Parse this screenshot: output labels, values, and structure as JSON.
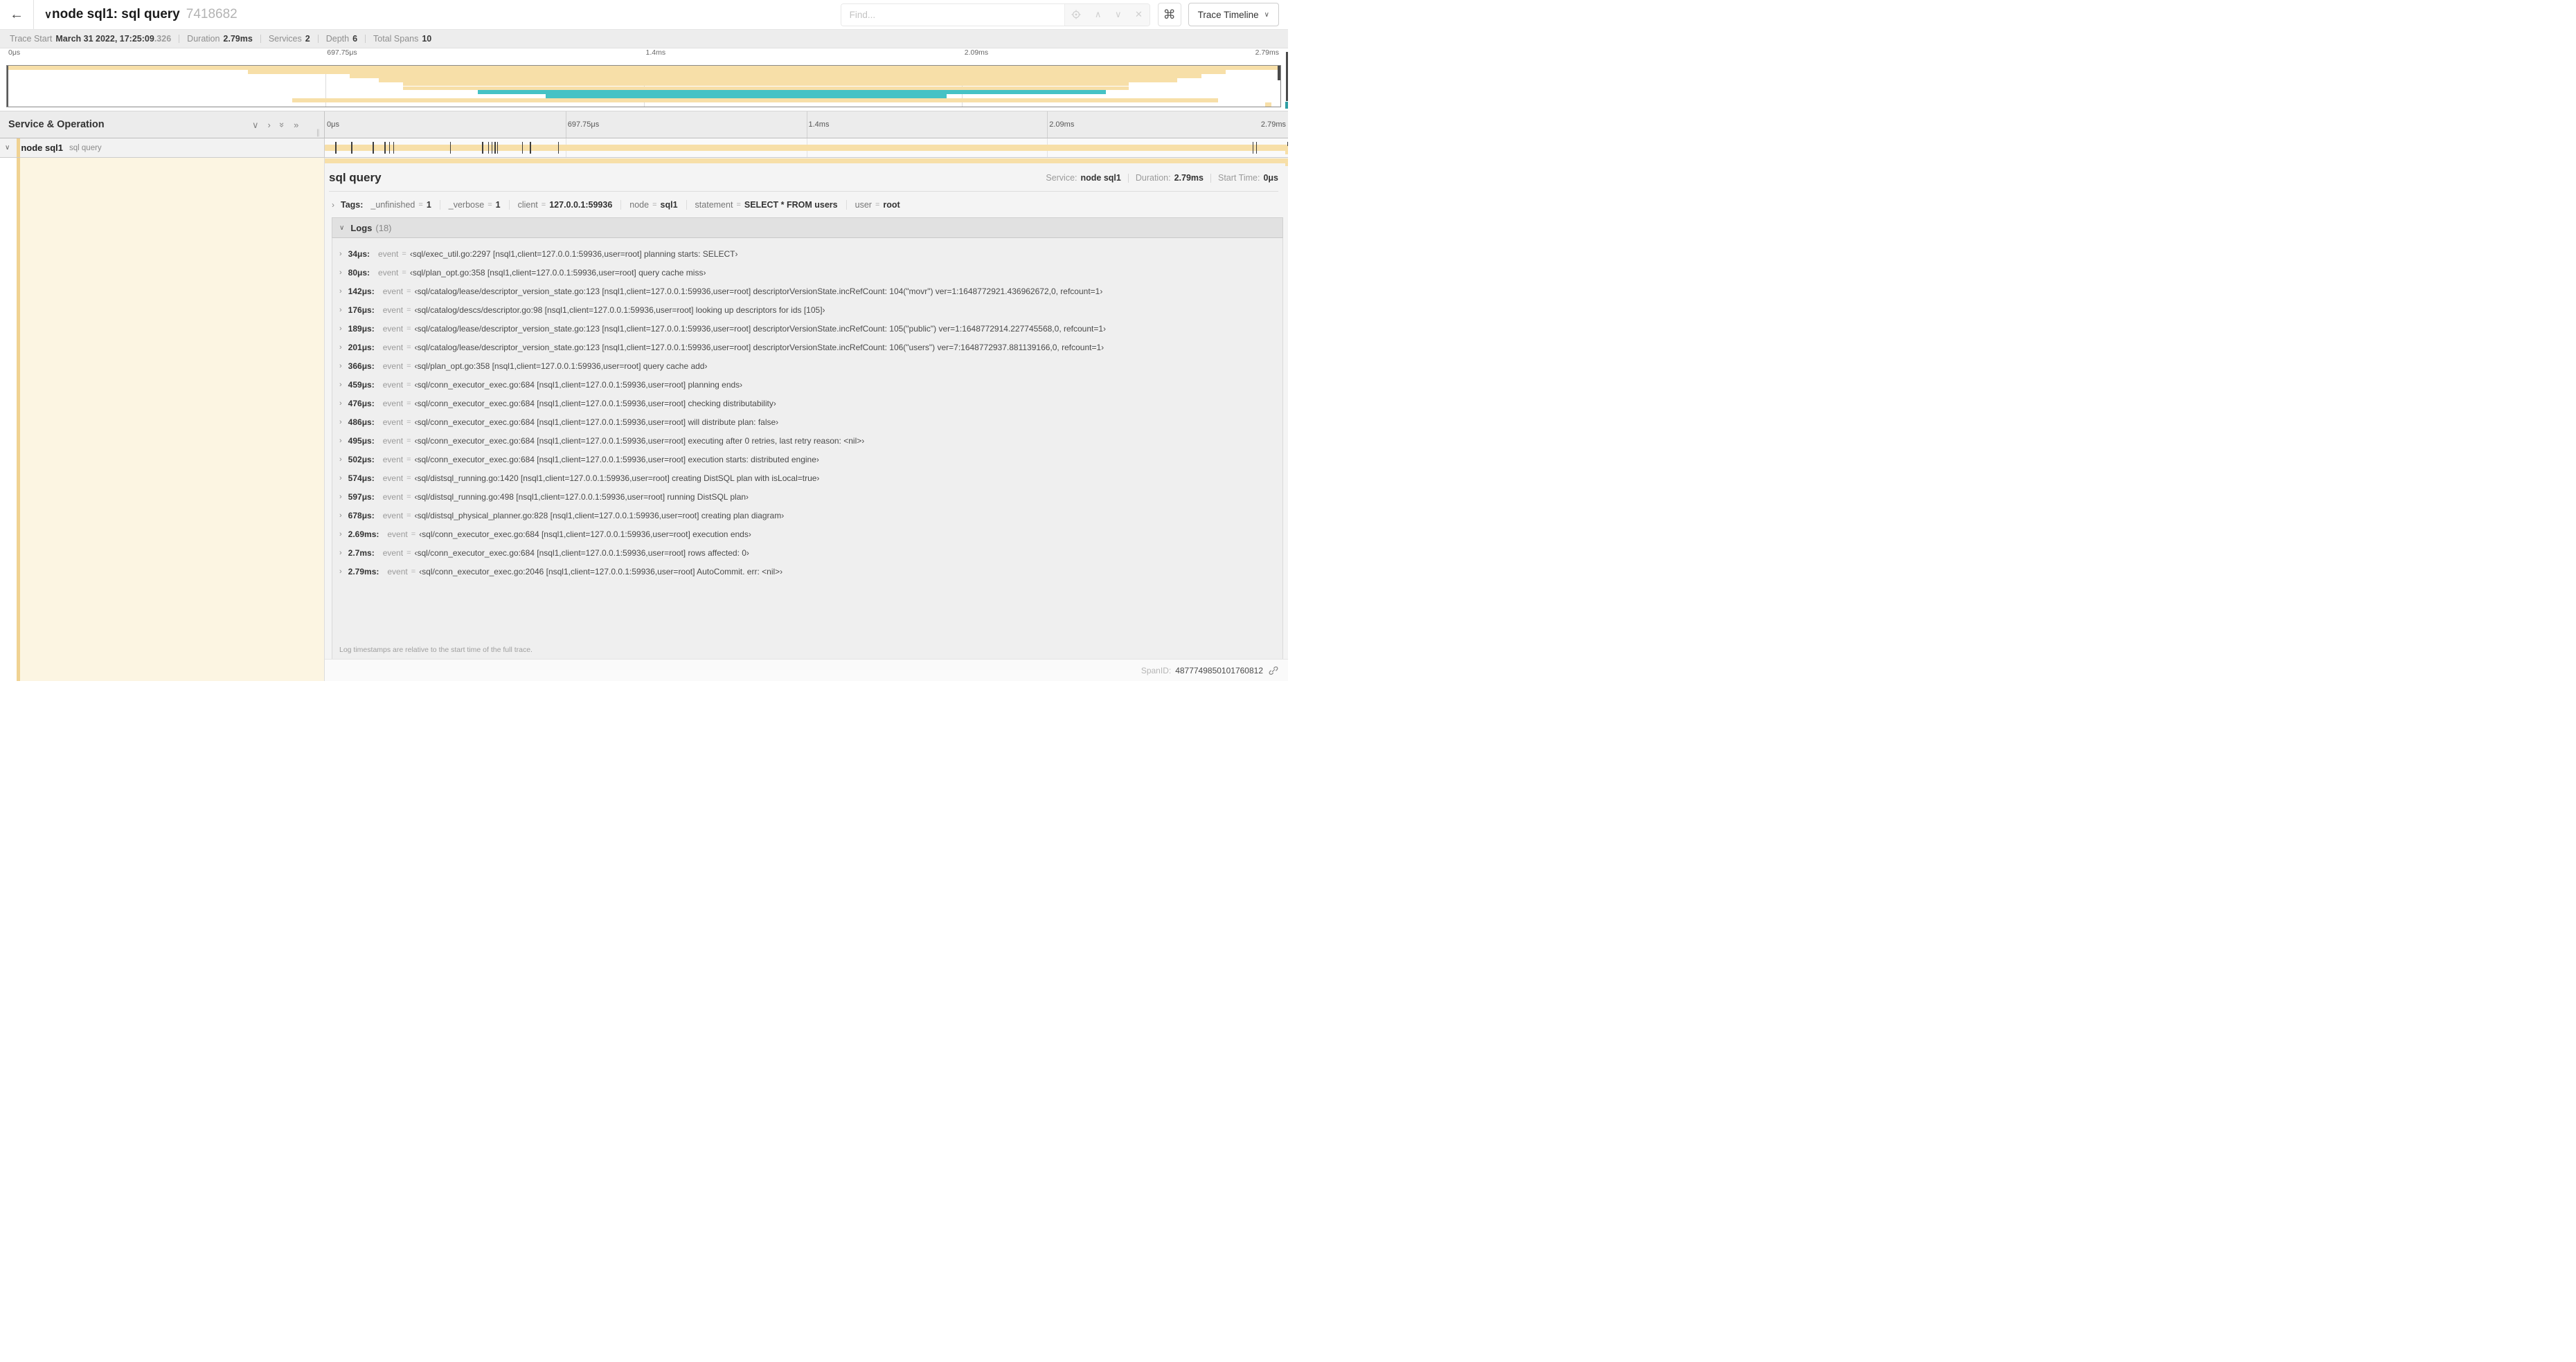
{
  "colors": {
    "span_tan": "#f7dfa8",
    "span_stripe": "#f0d292",
    "span_cream": "#fcf5e2",
    "teal": "#45c2c5",
    "edge_dark": "#4a4a4a",
    "edge_teal": "#2f9ea4"
  },
  "topbar": {
    "back_icon": "←",
    "collapse_icon": "∨",
    "title": "node sql1: sql query",
    "trace_id": "7418682",
    "find_placeholder": "Find...",
    "up_icon": "∧",
    "down_icon": "∨",
    "clear_icon": "✕",
    "command_icon": "⌘",
    "view_button": "Trace Timeline",
    "view_chevron": "∨"
  },
  "summary": {
    "items": [
      {
        "label": "Trace Start",
        "value": "March 31 2022, 17:25:09",
        "suffix": ".326"
      },
      {
        "label": "Duration",
        "value": "2.79ms"
      },
      {
        "label": "Services",
        "value": "2"
      },
      {
        "label": "Depth",
        "value": "6"
      },
      {
        "label": "Total Spans",
        "value": "10"
      }
    ]
  },
  "ticks": [
    "0μs",
    "697.75μs",
    "1.4ms",
    "2.09ms",
    "2.79ms"
  ],
  "minimap": {
    "rows": [
      {
        "start": 0.0,
        "end": 1.0,
        "color": "tan"
      },
      {
        "start": 0.189,
        "end": 0.957,
        "color": "tan"
      },
      {
        "start": 0.269,
        "end": 0.938,
        "color": "tan"
      },
      {
        "start": 0.292,
        "end": 0.919,
        "color": "tan"
      },
      {
        "start": 0.311,
        "end": 0.881,
        "color": "tan"
      },
      {
        "start": 0.311,
        "end": 0.881,
        "color": "tan"
      },
      {
        "start": 0.37,
        "end": 0.863,
        "color": "teal"
      },
      {
        "start": 0.423,
        "end": 0.738,
        "color": "teal"
      },
      {
        "start": 0.224,
        "end": 0.951,
        "color": "tan"
      },
      {
        "start": 0.988,
        "end": 0.993,
        "color": "tan"
      }
    ]
  },
  "timeline": {
    "column_header": "Service & Operation",
    "header_icons": [
      {
        "name": "collapse-one-icon",
        "glyph": "∨",
        "rot": 0
      },
      {
        "name": "expand-one-icon",
        "glyph": "›",
        "rot": 0
      },
      {
        "name": "collapse-all-icon",
        "glyph": "»",
        "rot": 90
      },
      {
        "name": "expand-all-icon",
        "glyph": "»",
        "rot": 0
      }
    ],
    "resizer_glyph": "∥"
  },
  "span": {
    "chevron": "∨",
    "service": "node sql1",
    "operation": "sql query",
    "duration_us": 2790,
    "log_times_us": [
      34,
      80,
      142,
      176,
      189,
      201,
      366,
      459,
      476,
      486,
      495,
      502,
      574,
      597,
      678,
      2690,
      2700,
      2790
    ]
  },
  "detail": {
    "title": "sql query",
    "service_label": "Service:",
    "service": "node sql1",
    "duration_label": "Duration:",
    "duration": "2.79ms",
    "start_label": "Start Time:",
    "start": "0μs"
  },
  "tags": {
    "chevron": "›",
    "label": "Tags:",
    "items": [
      {
        "key": "_unfinished",
        "value": "1"
      },
      {
        "key": "_verbose",
        "value": "1"
      },
      {
        "key": "client",
        "value": "127.0.0.1:59936"
      },
      {
        "key": "node",
        "value": "sql1"
      },
      {
        "key": "statement",
        "value": "SELECT * FROM users"
      },
      {
        "key": "user",
        "value": "root"
      }
    ]
  },
  "logs": {
    "chevron": "∨",
    "label": "Logs",
    "count": "(18)",
    "row_chevron": "›",
    "entries": [
      {
        "time": "34μs:",
        "key": "event",
        "value": "‹sql/exec_util.go:2297 [nsql1,client=127.0.0.1:59936,user=root] planning starts: SELECT›"
      },
      {
        "time": "80μs:",
        "key": "event",
        "value": "‹sql/plan_opt.go:358 [nsql1,client=127.0.0.1:59936,user=root] query cache miss›"
      },
      {
        "time": "142μs:",
        "key": "event",
        "value": "‹sql/catalog/lease/descriptor_version_state.go:123 [nsql1,client=127.0.0.1:59936,user=root] descriptorVersionState.incRefCount: 104(\"movr\") ver=1:1648772921.436962672,0, refcount=1›"
      },
      {
        "time": "176μs:",
        "key": "event",
        "value": "‹sql/catalog/descs/descriptor.go:98 [nsql1,client=127.0.0.1:59936,user=root] looking up descriptors for ids [105]›"
      },
      {
        "time": "189μs:",
        "key": "event",
        "value": "‹sql/catalog/lease/descriptor_version_state.go:123 [nsql1,client=127.0.0.1:59936,user=root] descriptorVersionState.incRefCount: 105(\"public\") ver=1:1648772914.227745568,0, refcount=1›"
      },
      {
        "time": "201μs:",
        "key": "event",
        "value": "‹sql/catalog/lease/descriptor_version_state.go:123 [nsql1,client=127.0.0.1:59936,user=root] descriptorVersionState.incRefCount: 106(\"users\") ver=7:1648772937.881139166,0, refcount=1›"
      },
      {
        "time": "366μs:",
        "key": "event",
        "value": "‹sql/plan_opt.go:358 [nsql1,client=127.0.0.1:59936,user=root] query cache add›"
      },
      {
        "time": "459μs:",
        "key": "event",
        "value": "‹sql/conn_executor_exec.go:684 [nsql1,client=127.0.0.1:59936,user=root] planning ends›"
      },
      {
        "time": "476μs:",
        "key": "event",
        "value": "‹sql/conn_executor_exec.go:684 [nsql1,client=127.0.0.1:59936,user=root] checking distributability›"
      },
      {
        "time": "486μs:",
        "key": "event",
        "value": "‹sql/conn_executor_exec.go:684 [nsql1,client=127.0.0.1:59936,user=root] will distribute plan: false›"
      },
      {
        "time": "495μs:",
        "key": "event",
        "value": "‹sql/conn_executor_exec.go:684 [nsql1,client=127.0.0.1:59936,user=root] executing after 0 retries, last retry reason: <nil>›"
      },
      {
        "time": "502μs:",
        "key": "event",
        "value": "‹sql/conn_executor_exec.go:684 [nsql1,client=127.0.0.1:59936,user=root] execution starts: distributed engine›"
      },
      {
        "time": "574μs:",
        "key": "event",
        "value": "‹sql/distsql_running.go:1420 [nsql1,client=127.0.0.1:59936,user=root] creating DistSQL plan with isLocal=true›"
      },
      {
        "time": "597μs:",
        "key": "event",
        "value": "‹sql/distsql_running.go:498 [nsql1,client=127.0.0.1:59936,user=root] running DistSQL plan›"
      },
      {
        "time": "678μs:",
        "key": "event",
        "value": "‹sql/distsql_physical_planner.go:828 [nsql1,client=127.0.0.1:59936,user=root] creating plan diagram›"
      },
      {
        "time": "2.69ms:",
        "key": "event",
        "value": "‹sql/conn_executor_exec.go:684 [nsql1,client=127.0.0.1:59936,user=root] execution ends›"
      },
      {
        "time": "2.7ms:",
        "key": "event",
        "value": "‹sql/conn_executor_exec.go:684 [nsql1,client=127.0.0.1:59936,user=root] rows affected: 0›"
      },
      {
        "time": "2.79ms:",
        "key": "event",
        "value": "‹sql/conn_executor_exec.go:2046 [nsql1,client=127.0.0.1:59936,user=root] AutoCommit. err: <nil>›"
      }
    ],
    "note": "Log timestamps are relative to the start time of the full trace."
  },
  "footer": {
    "spanid_label": "SpanID:",
    "spanid": "4877749850101760812"
  }
}
